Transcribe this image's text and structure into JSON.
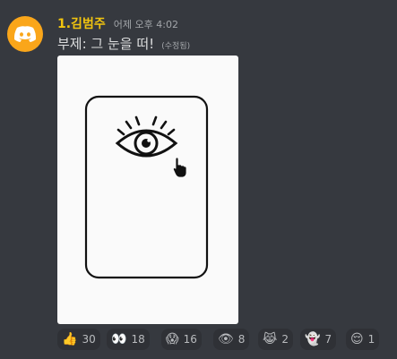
{
  "message": {
    "author": "1.김범주",
    "timestamp": "어제 오후 4:02",
    "text": "부제: 그 눈을 떠!",
    "edited_label": "(수정됨)",
    "avatar_icon": "discord-logo-icon",
    "author_color": "#f1c40f",
    "avatar_color": "#faa61a"
  },
  "attachment": {
    "content": "eye-card-drawing",
    "icons": [
      "eye-icon",
      "hand-pointer-icon"
    ]
  },
  "reactions": [
    {
      "emoji": "👍",
      "name": "thumbs-up",
      "count": "30"
    },
    {
      "emoji": "👀",
      "name": "eyes",
      "count": "18"
    },
    {
      "emoji": "😱",
      "name": "scream",
      "count": "16"
    },
    {
      "emoji": "👁",
      "name": "eye",
      "count": "8"
    },
    {
      "emoji": "😹",
      "name": "cat-face",
      "count": "2"
    },
    {
      "emoji": "👻",
      "name": "ghost",
      "count": "7"
    },
    {
      "emoji": "😌",
      "name": "relieved-face",
      "count": "1"
    }
  ]
}
